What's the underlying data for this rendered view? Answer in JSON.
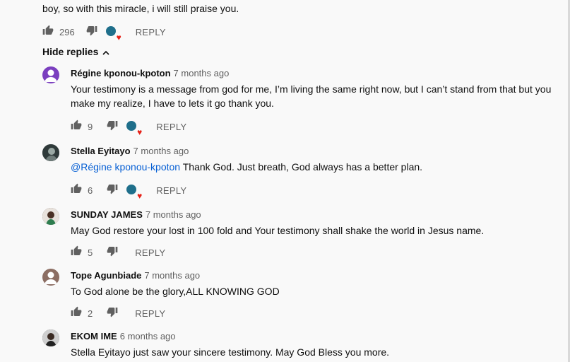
{
  "top_comment": {
    "text": "boy, so with this miracle, i will still praise you.",
    "likes": "296",
    "reply_label": "REPLY"
  },
  "hide_replies_label": "Hide replies",
  "replies": [
    {
      "author": "Régine kponou-kpoton",
      "time": "7 months ago",
      "text_line1": "Your testimony is a message from god for me, I’m living the same right now, but I can’t stand from that but you",
      "text_line2": "make my realize, I have to lets it go thank you.",
      "likes": "9",
      "reply_label": "REPLY",
      "avatar_color": "#7b3fbf"
    },
    {
      "author": "Stella Eyitayo",
      "time": "7 months ago",
      "mention": "@Régine kponou-kpoton",
      "text": " Thank God. Just breath, God always has a better plan.",
      "likes": "6",
      "reply_label": "REPLY",
      "avatar_color": "#4a5a5a"
    },
    {
      "author": "SUNDAY JAMES",
      "time": "7 months ago",
      "text": "May God restore your lost in 100 fold and Your testimony shall shake the world in Jesus name.",
      "likes": "5",
      "reply_label": "REPLY",
      "avatar_color": "#3a2a20"
    },
    {
      "author": "Tope Agunbiade",
      "time": "7 months ago",
      "text": "To God alone be the glory,ALL KNOWING GOD",
      "likes": "2",
      "reply_label": "REPLY",
      "avatar_color": "#8c6e63"
    },
    {
      "author": "EKOM IME",
      "time": "6 months ago",
      "text": "Stella Eyitayo just saw your sincere testimony. May God Bless you more.",
      "avatar_color": "#2e2e2e"
    }
  ],
  "colors": {
    "background": "#f9f9f9",
    "link": "#065fd4",
    "heart": "#e62117",
    "secondary_text": "#606060"
  }
}
